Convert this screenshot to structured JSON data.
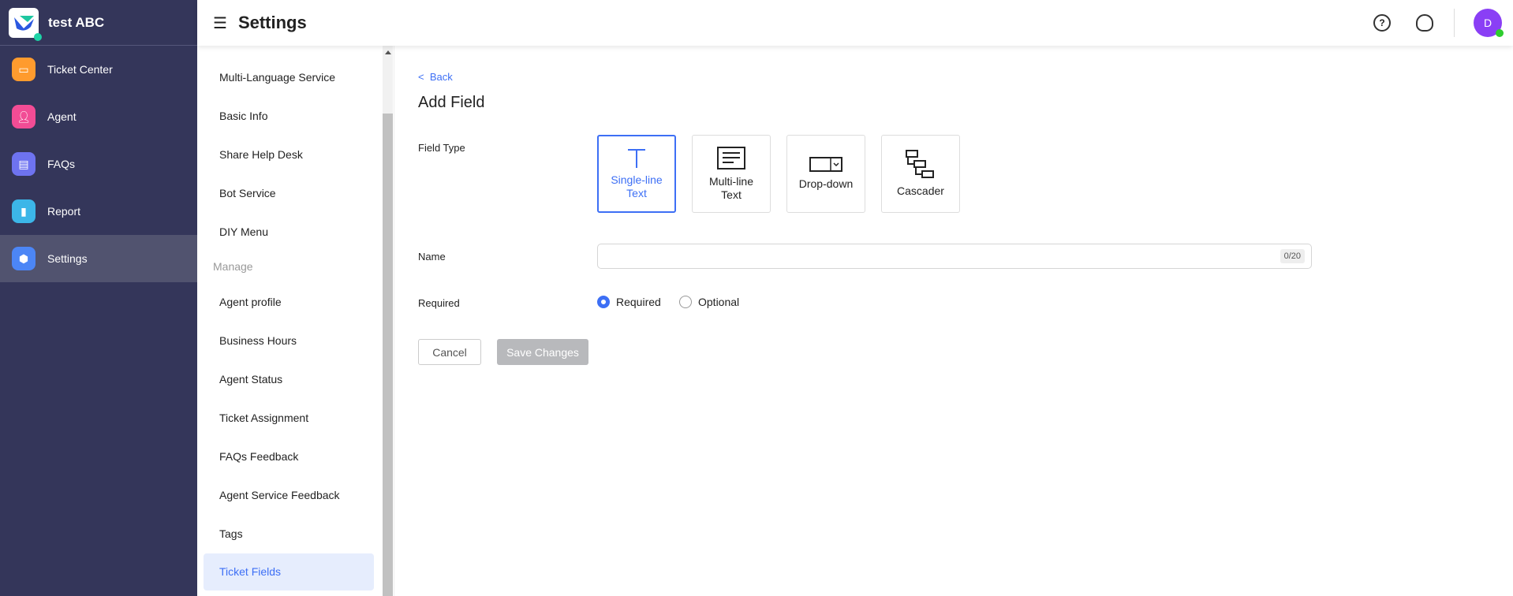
{
  "app": {
    "name": "test ABC"
  },
  "nav": [
    {
      "label": "Ticket Center",
      "color": "#ff9b2e"
    },
    {
      "label": "Agent",
      "color": "#f24c95"
    },
    {
      "label": "FAQs",
      "color": "#6e73f0"
    },
    {
      "label": "Report",
      "color": "#3cb6e8"
    },
    {
      "label": "Settings",
      "color": "#4c86f6"
    }
  ],
  "header": {
    "title": "Settings",
    "avatar": "D"
  },
  "submenu": {
    "items1": [
      "Multi-Language Service",
      "Basic Info",
      "Share Help Desk",
      "Bot Service",
      "DIY Menu"
    ],
    "group": "Manage",
    "items2": [
      "Agent profile",
      "Business Hours",
      "Agent Status",
      "Ticket Assignment",
      "FAQs Feedback",
      "Agent Service Feedback",
      "Tags"
    ],
    "selected": "Ticket Fields"
  },
  "form": {
    "back": "Back",
    "title": "Add Field",
    "field_type_label": "Field Type",
    "types": [
      {
        "line1": "Single-line",
        "line2": "Text"
      },
      {
        "line1": "Multi-line",
        "line2": "Text"
      },
      {
        "line1": "Drop-down",
        "line2": ""
      },
      {
        "line1": "Cascader",
        "line2": ""
      }
    ],
    "name_label": "Name",
    "name_value": "",
    "name_counter": "0/20",
    "required_label": "Required",
    "options": [
      "Required",
      "Optional"
    ],
    "selected_option": "Required",
    "cancel": "Cancel",
    "save": "Save Changes"
  }
}
